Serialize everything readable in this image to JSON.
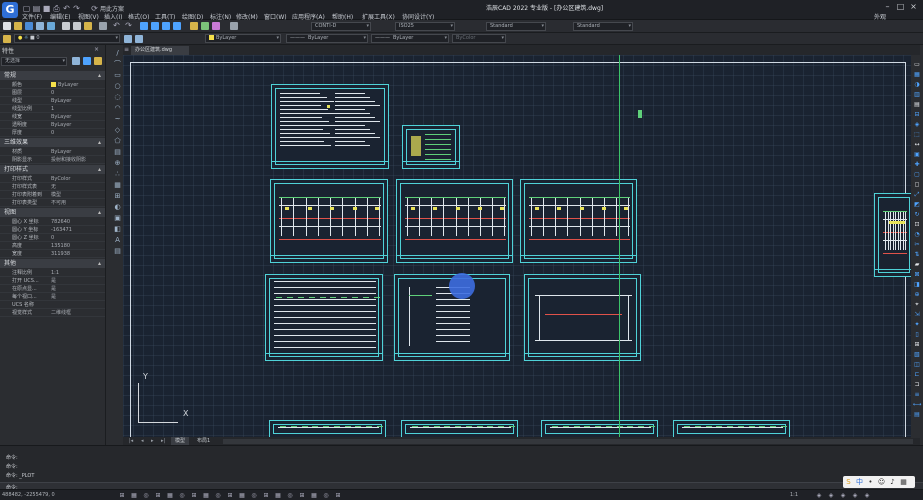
{
  "app": {
    "title": "浩辰CAD 2022 专业版 - [办公区建筑.dwg]",
    "quick_title": "用此方案",
    "user": "外观"
  },
  "menu": [
    "文件(F)",
    "编辑(E)",
    "视图(V)",
    "插入(I)",
    "格式(O)",
    "工具(T)",
    "绘图(D)",
    "标注(N)",
    "修改(M)",
    "窗口(W)",
    "应用程序(A)",
    "帮助(H)",
    "扩展工具(X)",
    "协同设计(Y)"
  ],
  "toolbar": {
    "layer_value": "0",
    "color_value": "ByLayer",
    "linetype_value": "ByLayer",
    "lineweight_value": "ByLayer",
    "plotstyle_value": "ByColor",
    "textstyle_value": "CONTI-D",
    "dimstyle_value": "ISO25",
    "tablestyle_value": "Standard",
    "mleaderstyle_value": "Standard"
  },
  "properties": {
    "title": "特性",
    "selection": "无选择",
    "sections": [
      {
        "name": "常规",
        "rows": [
          {
            "label": "颜色",
            "value": "ByLayer"
          },
          {
            "label": "图层",
            "value": "0"
          },
          {
            "label": "线型",
            "value": "ByLayer"
          },
          {
            "label": "线型比例",
            "value": "1"
          },
          {
            "label": "线宽",
            "value": "ByLayer"
          },
          {
            "label": "透明度",
            "value": "ByLayer"
          },
          {
            "label": "厚度",
            "value": "0"
          }
        ]
      },
      {
        "name": "三维效果",
        "rows": [
          {
            "label": "材质",
            "value": "ByLayer"
          },
          {
            "label": "阴影显示",
            "value": "投射和接收阴影"
          }
        ]
      },
      {
        "name": "打印样式",
        "rows": [
          {
            "label": "打印样式",
            "value": "ByColor"
          },
          {
            "label": "打印样式表",
            "value": "无"
          },
          {
            "label": "打印表附着到",
            "value": "模型"
          },
          {
            "label": "打印表类型",
            "value": "不可用"
          }
        ]
      },
      {
        "name": "视图",
        "rows": [
          {
            "label": "圆心 X 坐标",
            "value": "782640"
          },
          {
            "label": "圆心 Y 坐标",
            "value": "-163471"
          },
          {
            "label": "圆心 Z 坐标",
            "value": "0"
          },
          {
            "label": "高度",
            "value": "135180"
          },
          {
            "label": "宽度",
            "value": "311938"
          }
        ]
      },
      {
        "name": "其他",
        "rows": [
          {
            "label": "注释比例",
            "value": "1:1"
          },
          {
            "label": "打开 UCS...",
            "value": "是"
          },
          {
            "label": "在原点显...",
            "value": "是"
          },
          {
            "label": "每个视口...",
            "value": "是"
          },
          {
            "label": "UCS 名称",
            "value": ""
          },
          {
            "label": "视觉样式",
            "value": "二维线框"
          }
        ]
      }
    ]
  },
  "document": {
    "tab_label": "办公区建筑.dwg",
    "layout_tabs": [
      "模型",
      "布局1"
    ]
  },
  "ucs": {
    "y_label": "Y",
    "x_label": "X"
  },
  "command": {
    "lines": [
      "命令:",
      "命令:",
      "命令: _PLOT"
    ],
    "prompt": "命令:"
  },
  "status": {
    "coords": "488482, -2255479, 0",
    "scale": "1:1",
    "ime_lang": "中"
  },
  "colors": {
    "background": "#1a2331",
    "sheet_border": "#4fd2d8",
    "accent": "#3d6de0"
  }
}
